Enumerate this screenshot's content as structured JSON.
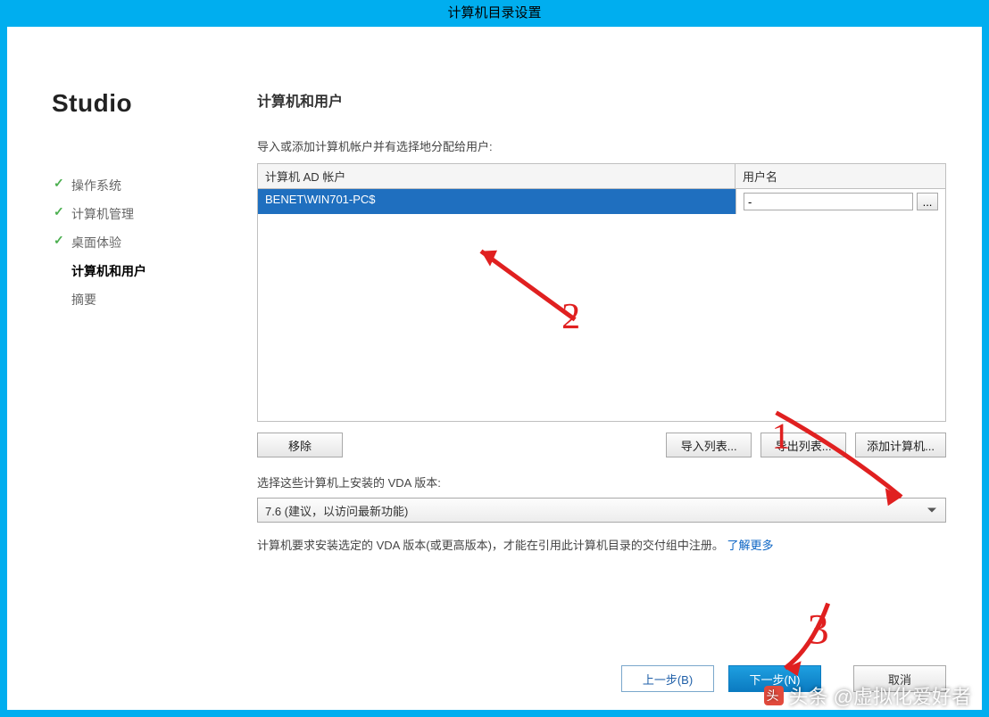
{
  "window": {
    "title": "计算机目录设置"
  },
  "brand": "Studio",
  "steps": [
    {
      "label": "操作系统",
      "state": "done"
    },
    {
      "label": "计算机管理",
      "state": "done"
    },
    {
      "label": "桌面体验",
      "state": "done"
    },
    {
      "label": "计算机和用户",
      "state": "active"
    },
    {
      "label": "摘要",
      "state": "pending"
    }
  ],
  "page": {
    "title": "计算机和用户",
    "instruction": "导入或添加计算机帐户并有选择地分配给用户:",
    "columns": {
      "account": "计算机 AD 帐户",
      "user": "用户名"
    },
    "rows": [
      {
        "account": "BENET\\WIN701-PC$",
        "user": "-",
        "selected": true
      }
    ],
    "buttons": {
      "remove": "移除",
      "importList": "导入列表...",
      "exportList": "导出列表...",
      "addComputer": "添加计算机..."
    },
    "vdaLabel": "选择这些计算机上安装的 VDA 版本:",
    "vdaSelected": "7.6 (建议，以访问最新功能)",
    "noteBefore": "计算机要求安装选定的 VDA 版本(或更高版本)，才能在引用此计算机目录的交付组中注册。",
    "noteLink": "了解更多"
  },
  "wizard": {
    "back": "上一步(B)",
    "next": "下一步(N)",
    "cancel": "取消"
  },
  "watermark": "头条 @虚拟化爱好者",
  "annotations": {
    "one": "1",
    "two": "2",
    "three": "3"
  }
}
